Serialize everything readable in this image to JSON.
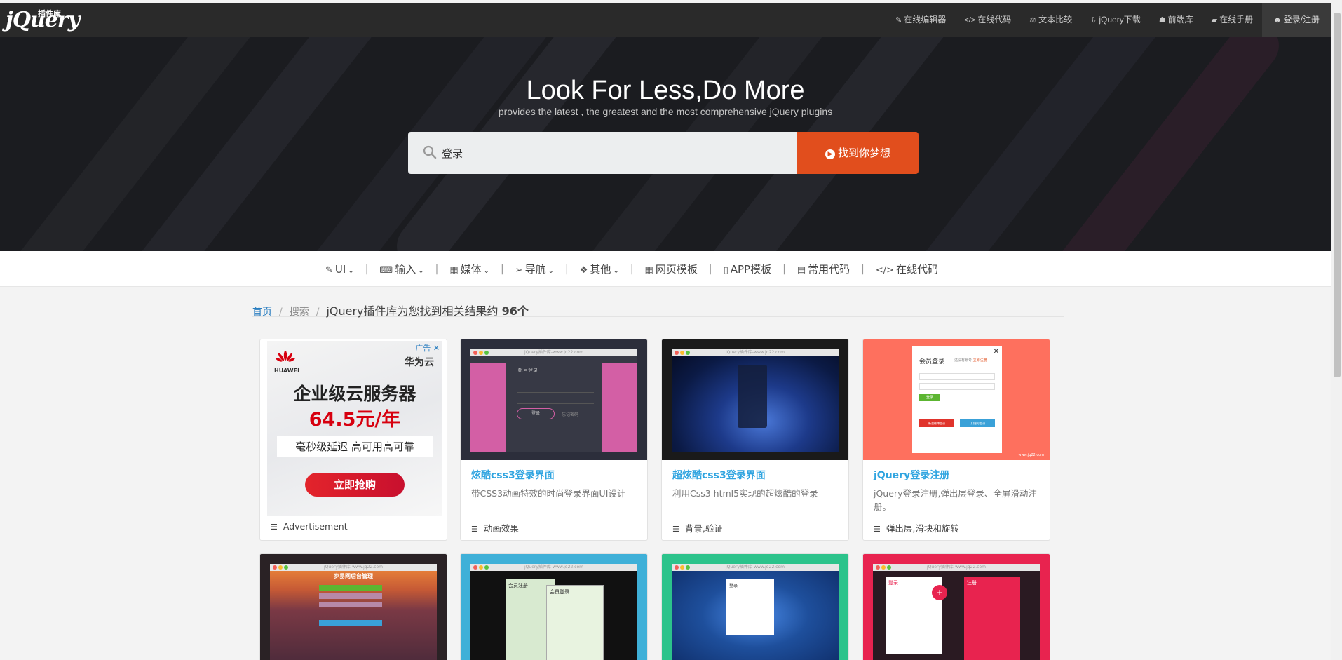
{
  "site": {
    "logo_text": "jQuery",
    "logo_sub": "插件库"
  },
  "topnav": [
    {
      "label": "在线编辑器",
      "icon": "edit-icon",
      "glyph": "✎"
    },
    {
      "label": "在线代码",
      "icon": "code-icon",
      "glyph": "</>"
    },
    {
      "label": "文本比较",
      "icon": "balance-icon",
      "glyph": "⚖"
    },
    {
      "label": "jQuery下载",
      "icon": "download-icon",
      "glyph": "⇩"
    },
    {
      "label": "前端库",
      "icon": "user-secret-icon",
      "glyph": "☗"
    },
    {
      "label": "在线手册",
      "icon": "book-icon",
      "glyph": "▰"
    },
    {
      "label": "登录/注册",
      "icon": "user-icon",
      "glyph": "☻"
    }
  ],
  "hero": {
    "title": "Look For Less,Do More",
    "subtitle": "provides the latest , the greatest and the most comprehensive jQuery plugins"
  },
  "search": {
    "value": "登录",
    "button_label": "找到你梦想"
  },
  "categories": [
    {
      "label": "UI",
      "icon": "brush-icon",
      "glyph": "✎",
      "dropdown": true
    },
    {
      "label": "输入",
      "icon": "keyboard-icon",
      "glyph": "⌨",
      "dropdown": true
    },
    {
      "label": "媒体",
      "icon": "film-icon",
      "glyph": "▦",
      "dropdown": true
    },
    {
      "label": "导航",
      "icon": "send-icon",
      "glyph": "➢",
      "dropdown": true
    },
    {
      "label": "其他",
      "icon": "dropbox-icon",
      "glyph": "❖",
      "dropdown": true
    },
    {
      "label": "网页模板",
      "icon": "th-large-icon",
      "glyph": "▦",
      "dropdown": false
    },
    {
      "label": "APP模板",
      "icon": "mobile-icon",
      "glyph": "▯",
      "dropdown": false
    },
    {
      "label": "常用代码",
      "icon": "file-code-icon",
      "glyph": "▤",
      "dropdown": false
    },
    {
      "label": "在线代码",
      "icon": "code-icon",
      "glyph": "</>",
      "dropdown": false
    }
  ],
  "breadcrumb": {
    "home": "首页",
    "current": "搜索",
    "result_prefix": "jQuery插件库为您找到相关结果约",
    "result_count": "96个"
  },
  "ad": {
    "badge": "广告",
    "brand": "HUAWEI",
    "brand_cn": "华为云",
    "headline": "企业级云服务器",
    "price": "64.5元/年",
    "feature": "毫秒级延迟 高可用高可靠",
    "cta": "立即抢购",
    "footer": "Advertisement"
  },
  "cards": [
    {
      "title": "炫酷css3登录界面",
      "desc": "带CSS3动画特效的时尚登录界面UI设计",
      "tag": "动画效果",
      "thumb_bar": "jQuery插件库-www.jq22.com",
      "thumb_text": "帐号登录",
      "thumb_btn": "登录",
      "thumb_link": "忘记密码"
    },
    {
      "title": "超炫酷css3登录界面",
      "desc": "利用Css3 html5实现的超炫酷的登录",
      "tag": "背景,验证",
      "thumb_bar": "jQuery插件库-www.jq22.com"
    },
    {
      "title": "jQuery登录注册",
      "desc": "jQuery登录注册,弹出层登录、全屏滑动注册。",
      "tag": "弹出层,滑块和旋转",
      "thumb_title": "会员登录",
      "thumb_link": "还没有账号",
      "thumb_link2": "立即注册",
      "thumb_btn": "登录",
      "thumb_weibo": "新浪微博登录",
      "thumb_qq": "QQ账号登录",
      "thumb_url": "www.jq22.com"
    }
  ],
  "row2_thumbs": [
    {
      "bar": "jQuery插件库-www.jq22.com",
      "text": "步易网后台管理"
    },
    {
      "bar": "jQuery插件库-www.jq22.com",
      "text": "会员注册",
      "text2": "会员登录"
    },
    {
      "bar": "jQuery插件库-www.jq22.com",
      "text": "登录"
    },
    {
      "bar": "jQuery插件库-www.jq22.com",
      "text": "登录",
      "text2": "注册"
    }
  ],
  "colors": {
    "accent": "#e14e1d",
    "link": "#2fa4e0",
    "nav_bg": "#2a2a2a",
    "hero_bg": "#1b1c20"
  }
}
